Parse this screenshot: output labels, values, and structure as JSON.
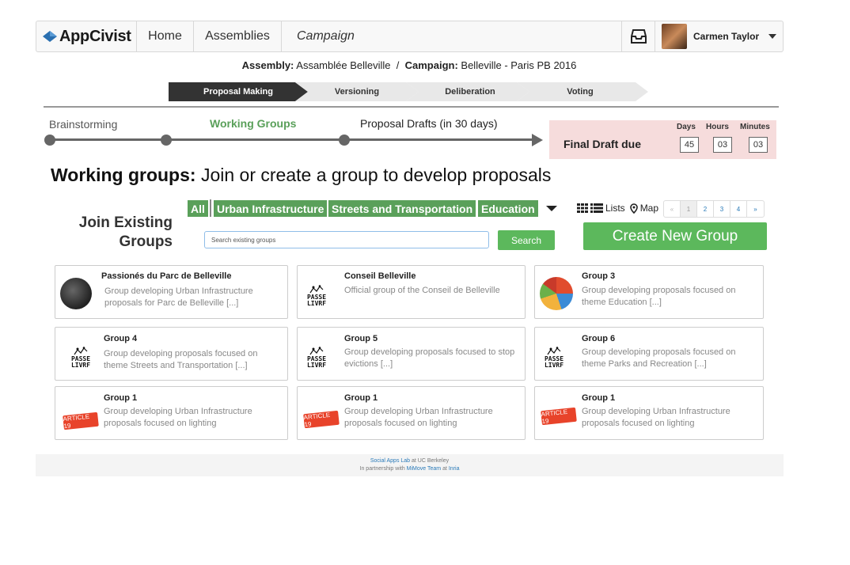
{
  "nav": {
    "brand": "AppCivist",
    "items": [
      "Home",
      "Assemblies",
      "Campaign"
    ],
    "user_name": "Carmen Taylor"
  },
  "breadcrumb": {
    "assembly_label": "Assembly:",
    "assembly_value": "Assamblée Belleville",
    "separator": "/",
    "campaign_label": "Campaign:",
    "campaign_value": "Belleville - Paris PB 2016"
  },
  "phases": [
    "Proposal Making",
    "Versioning",
    "Deliberation",
    "Voting"
  ],
  "timeline": {
    "stages": [
      "Brainstorming",
      "Working Groups",
      "Proposal Drafts (in 30 days)"
    ],
    "deadline_title": "Final Draft due",
    "columns": [
      "Days",
      "Hours",
      "Minutes"
    ],
    "values": [
      "45",
      "03",
      "03"
    ]
  },
  "heading": {
    "bold": "Working groups:",
    "rest": "Join or create a group to develop proposals"
  },
  "join_label": "Join Existing Groups",
  "filters": [
    "All",
    "Urban Infrastructure",
    "Streets and Transportation",
    "Education"
  ],
  "view": {
    "lists": "Lists",
    "map": "Map"
  },
  "pagination": [
    "«",
    "1",
    "2",
    "3",
    "4",
    "»"
  ],
  "search": {
    "placeholder": "Search existing groups",
    "button": "Search"
  },
  "create_button": "Create New Group",
  "groups": [
    {
      "title": "Passionés du Parc de Belleville",
      "desc": "Group developing Urban Infrastructure proposals for Parc de Belleville [...]",
      "logo": "dark-round"
    },
    {
      "title": "Conseil Belleville",
      "desc": "Official group of the Conseil de Belleville",
      "logo": "passe-livre"
    },
    {
      "title": "Group 3",
      "desc": "Group developing proposals focused on theme Education [...]",
      "logo": "colorful-round"
    },
    {
      "title": "Group 4",
      "desc": "Group developing proposals focused on theme Streets and Transportation [...]",
      "logo": "passe-livre"
    },
    {
      "title": "Group 5",
      "desc": "Group developing proposals focused to stop evictions [...]",
      "logo": "passe-livre"
    },
    {
      "title": "Group 6",
      "desc": "Group developing proposals focused on theme Parks and Recreation [...]",
      "logo": "passe-livre"
    },
    {
      "title": "Group 1",
      "desc": "Group developing Urban Infrastructure proposals focused on lighting",
      "logo": "article-19"
    },
    {
      "title": "Group 1",
      "desc": "Group developing Urban Infrastructure proposals focused on lighting",
      "logo": "article-19"
    },
    {
      "title": "Group 1",
      "desc": "Group developing Urban Infrastructure proposals focused on lighting",
      "logo": "article-19"
    }
  ],
  "logo_text": {
    "passe1": "PASSE",
    "passe2": "LIVRF",
    "article": "ARTICLE 19"
  },
  "footer": {
    "line1_link": "Social Apps Lab",
    "line1_rest": " at UC Berkeley",
    "line2_pre": "In partnership with ",
    "line2_link1": "MiMove Team",
    "line2_mid": " at ",
    "line2_link2": "Inria"
  },
  "colors": {
    "accent_green": "#5cb85c",
    "filter_green": "#5aa05a",
    "deadline_bg": "#f6dcdc",
    "phase_active": "#333333"
  }
}
